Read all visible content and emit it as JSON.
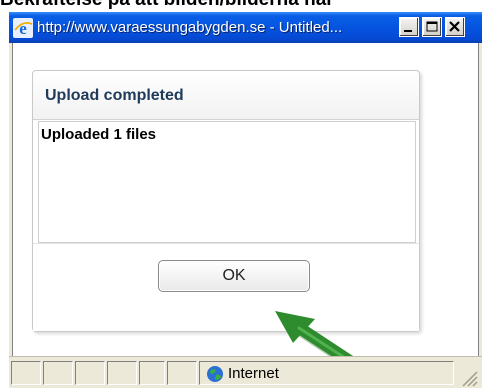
{
  "page": {
    "caption": "Bekräftelse på att bilden/bilderna har"
  },
  "window": {
    "title": "http://www.varaessungabygden.se - Untitled...",
    "controls": [
      "minimize",
      "maximize",
      "close"
    ],
    "titlebar_color": "#0554e0"
  },
  "dialog": {
    "title": "Upload completed",
    "message": "Uploaded 1 files",
    "ok_label": "OK"
  },
  "annotation": {
    "arrow_color": "#2e8b2e",
    "arrow_target": "ok-button"
  },
  "statusbar": {
    "zone_label": "Internet",
    "zone_icon": "globe-icon"
  }
}
